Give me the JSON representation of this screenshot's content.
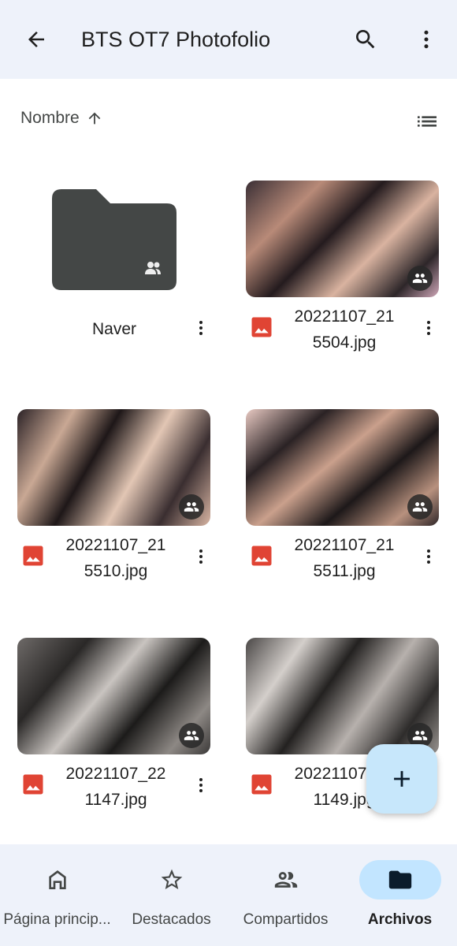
{
  "app_bar": {
    "title": "BTS OT7 Photofolio",
    "back_icon": "arrow-back-icon",
    "search_icon": "search-icon",
    "more_icon": "more-vert-icon"
  },
  "sort": {
    "label": "Nombre",
    "direction_icon": "arrow-upward-icon",
    "view_icon": "list-view-icon"
  },
  "items": [
    {
      "type": "folder",
      "name": "Naver",
      "shared": true
    },
    {
      "type": "image",
      "name_line1": "20221107_21",
      "name_line2": "5504.jpg",
      "shared": true
    },
    {
      "type": "image",
      "name_line1": "20221107_21",
      "name_line2": "5510.jpg",
      "shared": true
    },
    {
      "type": "image",
      "name_line1": "20221107_21",
      "name_line2": "5511.jpg",
      "shared": true
    },
    {
      "type": "image",
      "name_line1": "20221107_22",
      "name_line2": "1147.jpg",
      "shared": true
    },
    {
      "type": "image",
      "name_line1": "20221107_22",
      "name_line2": "1149.jpg",
      "shared": true
    }
  ],
  "fab": {
    "icon": "add-icon"
  },
  "bottom_nav": [
    {
      "label": "Página princip...",
      "icon": "home-icon",
      "active": false
    },
    {
      "label": "Destacados",
      "icon": "star-icon",
      "active": false
    },
    {
      "label": "Compartidos",
      "icon": "people-icon",
      "active": false
    },
    {
      "label": "Archivos",
      "icon": "folder-icon",
      "active": true
    }
  ],
  "colors": {
    "bar_background": "#eef2fa",
    "active_pill": "#c2e5ff",
    "fab_background": "#c7e7fb",
    "image_file_icon": "#e04434",
    "folder": "#444746"
  }
}
